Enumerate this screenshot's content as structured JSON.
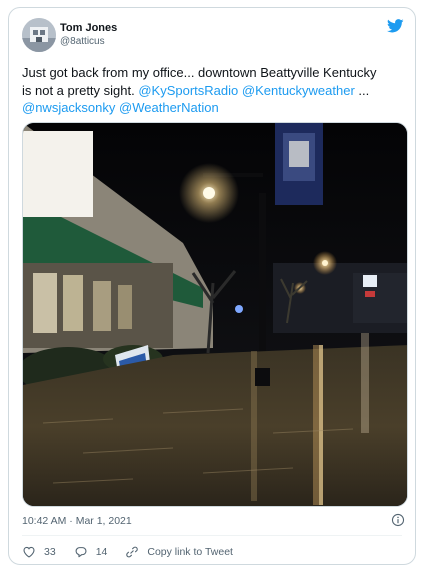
{
  "author": {
    "name": "Tom Jones",
    "handle": "@8atticus",
    "avatar_icon": "profile-photo",
    "platform_icon": "twitter-bird-icon"
  },
  "tweet": {
    "lines": [
      [
        {
          "text": "Just got back from my office... downtown Beattyville Kentucky",
          "link": false
        }
      ],
      [
        {
          "text": "is not a pretty sight. ",
          "link": false
        },
        {
          "text": "@KySportsRadio",
          "link": true
        },
        {
          "text": " ",
          "link": false
        },
        {
          "text": "@Kentuckyweather",
          "link": true
        },
        {
          "text": " ...",
          "link": false
        }
      ],
      [
        {
          "text": "@nwsjacksonky",
          "link": true
        },
        {
          "text": " ",
          "link": false
        },
        {
          "text": "@WeatherNation",
          "link": true
        }
      ]
    ]
  },
  "media": {
    "type": "photo",
    "subject": "flooded street at night"
  },
  "meta": {
    "timestamp": "10:42 AM · Mar 1, 2021",
    "info_icon": "info-icon"
  },
  "actions": [
    {
      "name": "like-button",
      "icon": "heart-icon",
      "label": "33"
    },
    {
      "name": "reply-button",
      "icon": "reply-icon",
      "label": "14"
    },
    {
      "name": "copy-link-button",
      "icon": "link-icon",
      "label": "Copy link to Tweet"
    }
  ],
  "colors": {
    "link": "#1d9bf0",
    "text": "#0f1419",
    "secondary": "#536471",
    "border": "#cfd9de"
  }
}
